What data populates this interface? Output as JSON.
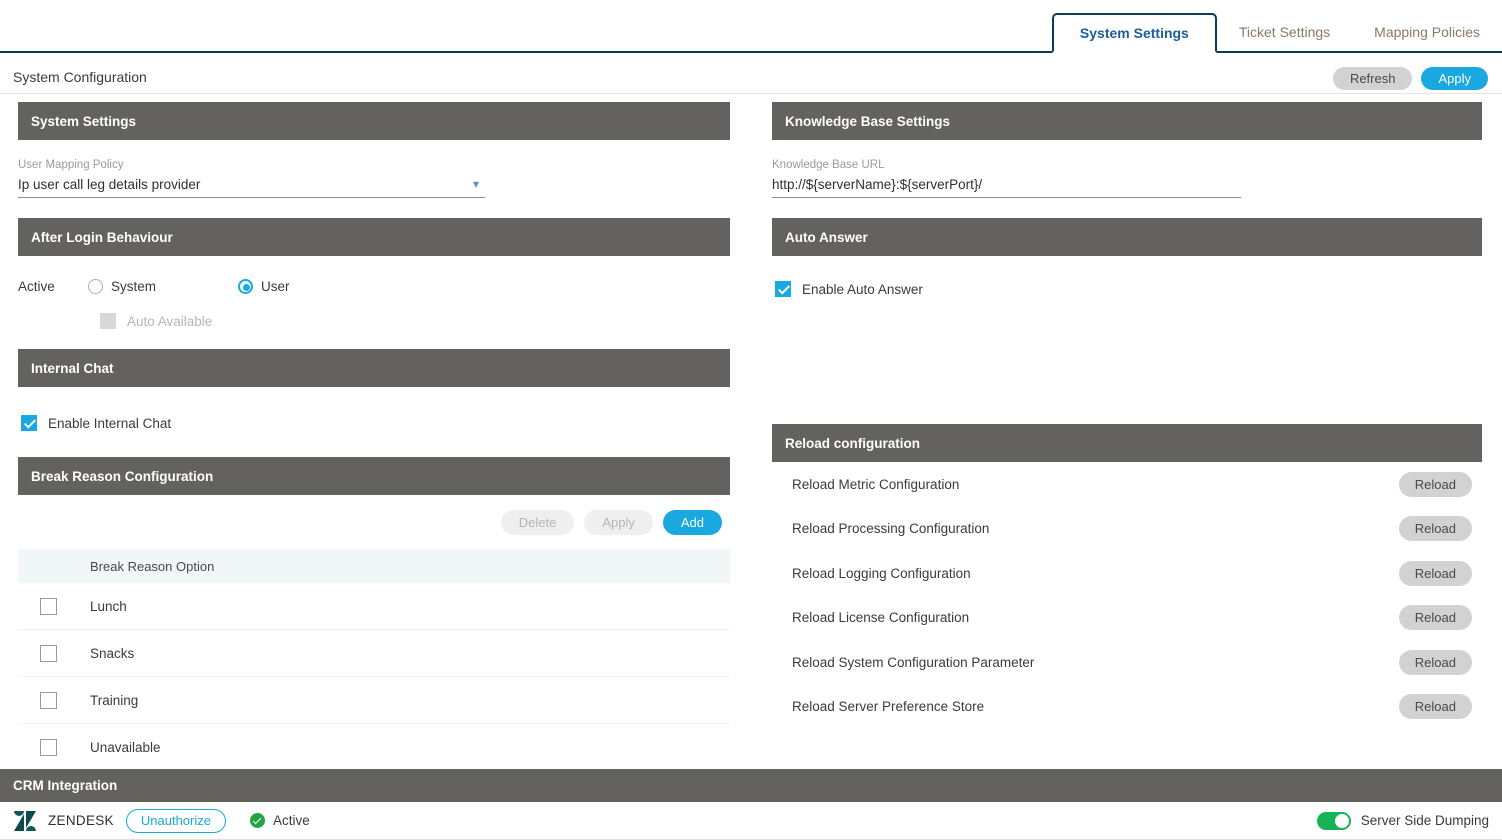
{
  "tabs": [
    {
      "label": "System Settings",
      "active": true
    },
    {
      "label": "Ticket Settings",
      "active": false
    },
    {
      "label": "Mapping Policies",
      "active": false
    }
  ],
  "header": {
    "title": "System Configuration",
    "refresh_label": "Refresh",
    "apply_label": "Apply"
  },
  "left": {
    "system_settings": {
      "section_title": "System Settings",
      "user_mapping_policy_label": "User Mapping Policy",
      "user_mapping_policy_value": "Ip user call leg details provider"
    },
    "after_login": {
      "section_title": "After Login Behaviour",
      "active_label": "Active",
      "radio_system": "System",
      "radio_user": "User",
      "selected": "User",
      "auto_available_label": "Auto Available",
      "auto_available_checked": false,
      "auto_available_disabled": true
    },
    "internal_chat": {
      "section_title": "Internal Chat",
      "enable_label": "Enable Internal Chat",
      "enabled": true
    },
    "break_reason": {
      "section_title": "Break Reason Configuration",
      "delete_label": "Delete",
      "apply_label": "Apply",
      "add_label": "Add",
      "column_header": "Break Reason Option",
      "rows": [
        {
          "name": "Lunch",
          "checked": false
        },
        {
          "name": "Snacks",
          "checked": false
        },
        {
          "name": "Training",
          "checked": false
        },
        {
          "name": "Unavailable",
          "checked": false
        }
      ]
    }
  },
  "right": {
    "knowledge_base": {
      "section_title": "Knowledge Base Settings",
      "url_label": "Knowledge Base URL",
      "url_value": "http://${serverName}:${serverPort}/"
    },
    "auto_answer": {
      "section_title": "Auto Answer",
      "enable_label": "Enable Auto Answer",
      "enabled": true
    },
    "reload": {
      "section_title": "Reload configuration",
      "button_label": "Reload",
      "items": [
        "Reload Metric Configuration",
        "Reload Processing Configuration",
        "Reload Logging Configuration",
        "Reload License Configuration",
        "Reload System Configuration Parameter",
        "Reload Server Preference Store"
      ]
    }
  },
  "crm": {
    "section_title": "CRM Integration",
    "provider_name": "ZENDESK",
    "unauthorize_label": "Unauthorize",
    "status_label": "Active",
    "server_side_dumping_label": "Server Side Dumping",
    "server_side_dumping_on": true
  },
  "colors": {
    "section_header_bg": "#63625F",
    "accent_blue": "#19A8E0",
    "tab_active_text": "#1B5E9E",
    "tab_border": "#103A5D",
    "status_green": "#22A544",
    "toggle_green": "#16B455"
  }
}
